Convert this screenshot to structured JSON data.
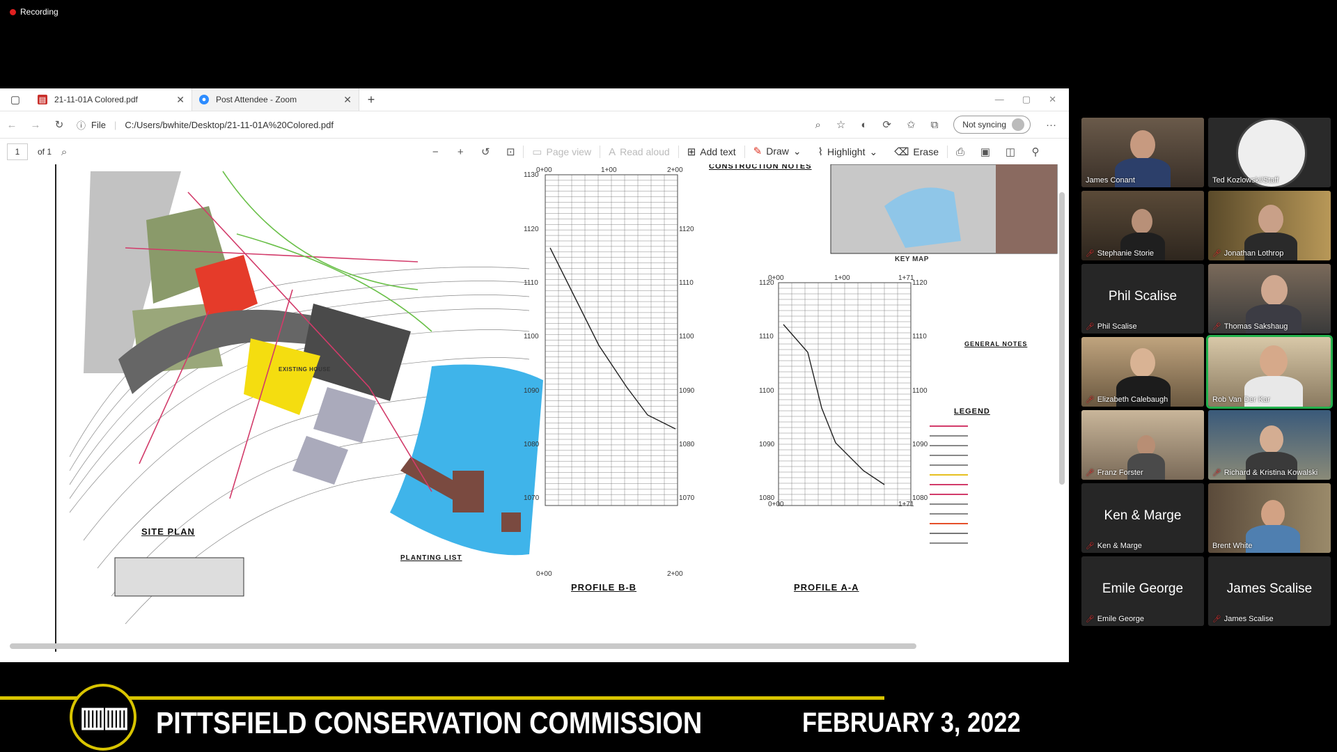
{
  "recording": {
    "label": "Recording"
  },
  "browser": {
    "tabs": [
      {
        "label": "21-11-01A Colored.pdf",
        "active": true
      },
      {
        "label": "Post Attendee - Zoom",
        "active": false
      }
    ],
    "address": {
      "scheme_label": "File",
      "url": "C:/Users/bwhite/Desktop/21-11-01A%20Colored.pdf"
    },
    "sync": {
      "label": "Not syncing"
    }
  },
  "pdf_toolbar": {
    "page_number": "1",
    "page_of": "of 1",
    "page_view": "Page view",
    "read_aloud": "Read aloud",
    "add_text": "Add text",
    "draw": "Draw",
    "highlight": "Highlight",
    "erase": "Erase"
  },
  "drawing": {
    "site_plan_title": "SITE PLAN",
    "planting_list_title": "PLANTING LIST",
    "construction_notes_title": "CONSTRUCTION NOTES",
    "key_map_label": "KEY MAP",
    "general_notes_title": "GENERAL NOTES",
    "legend_title": "LEGEND",
    "existing_house_label": "EXISTING HOUSE",
    "profile_bb": {
      "title": "PROFILE B-B",
      "stations": [
        "0+00",
        "1+00",
        "2+00"
      ],
      "elevations": [
        "1130",
        "1120",
        "1110",
        "1100",
        "1090",
        "1080",
        "1070"
      ]
    },
    "profile_aa": {
      "title": "PROFILE A-A",
      "stations": [
        "0+00",
        "1+00",
        "1+71"
      ],
      "elevations": [
        "1120",
        "1110",
        "1100",
        "1090",
        "1080"
      ]
    }
  },
  "participants": [
    {
      "name": "James Conant",
      "video": true
    },
    {
      "name": "Ted Kozlowski/Staff",
      "video": true
    },
    {
      "name": "Stephanie Storie",
      "video": true,
      "muted": true
    },
    {
      "name": "Jonathan Lothrop",
      "video": true,
      "muted": true
    },
    {
      "name": "Phil Scalise",
      "video": false,
      "muted": true
    },
    {
      "name": "Thomas Sakshaug",
      "video": true,
      "muted": true
    },
    {
      "name": "Elizabeth Calebaugh",
      "video": true,
      "muted": true
    },
    {
      "name": "Rob Van Der Kar",
      "video": true,
      "speaking": true
    },
    {
      "name": "Franz Forster",
      "video": true,
      "muted": true
    },
    {
      "name": "Richard & Kristina Kowalski",
      "video": true,
      "muted": true
    },
    {
      "name": "Ken & Marge",
      "video": false,
      "muted": true
    },
    {
      "name": "Brent White",
      "video": true
    },
    {
      "name": "Emile George",
      "video": false,
      "muted": true
    },
    {
      "name": "James Scalise",
      "video": false,
      "muted": true
    }
  ],
  "banner": {
    "title": "PITTSFIELD CONSERVATION COMMISSION",
    "date": "FEBRUARY 3, 2022"
  }
}
